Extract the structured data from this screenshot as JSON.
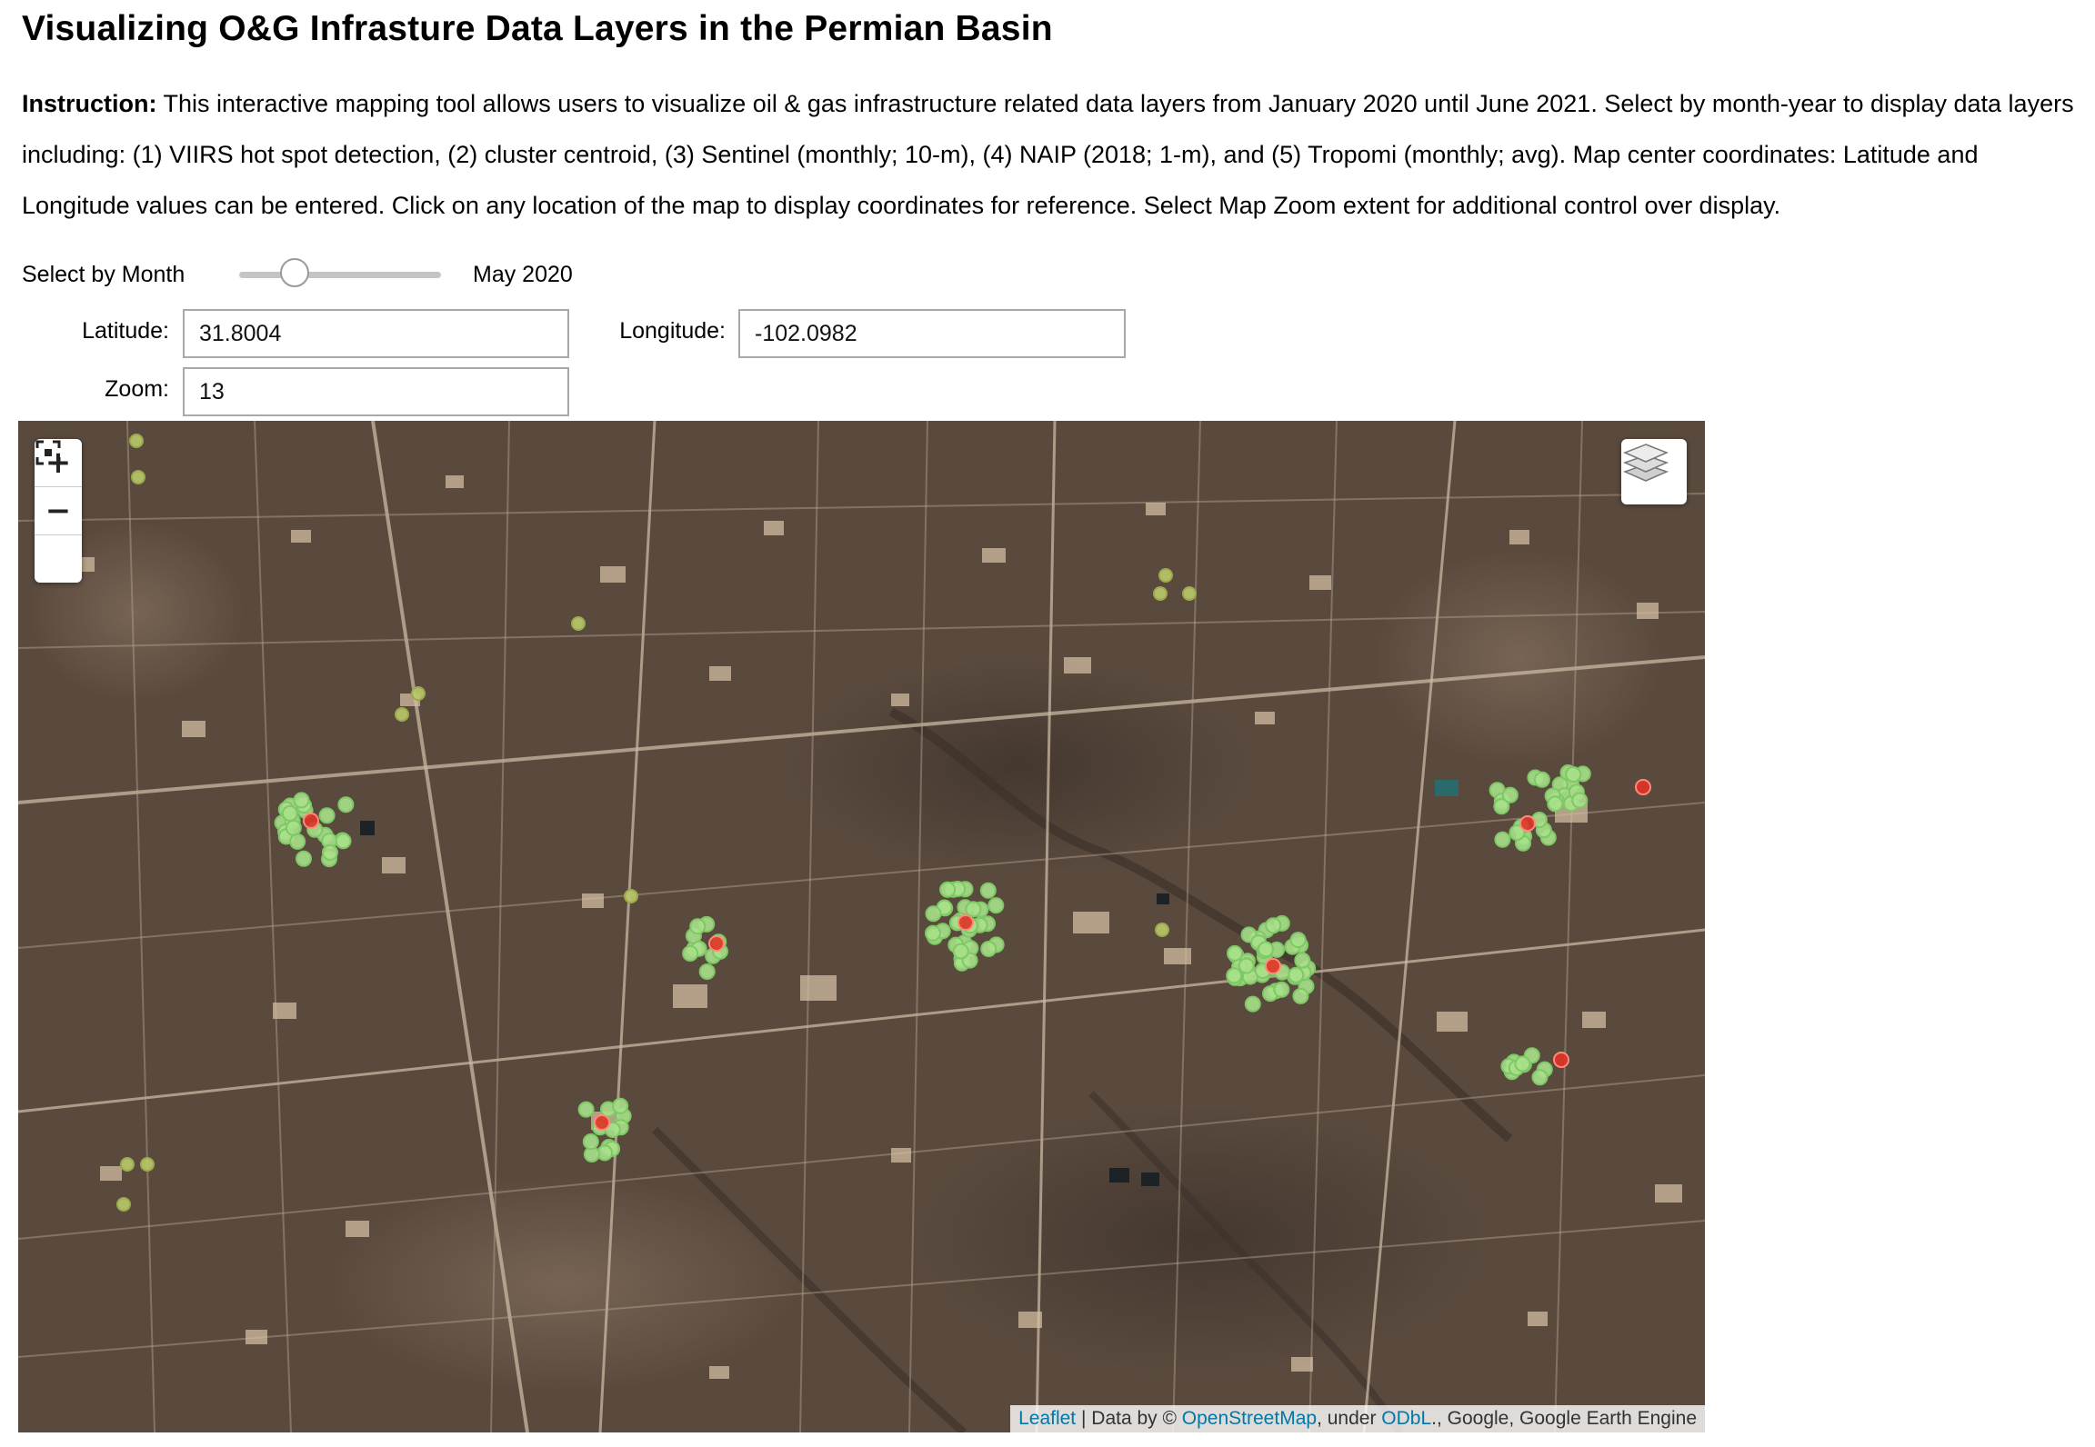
{
  "page": {
    "title": "Visualizing O&G Infrasture Data Layers in the Permian Basin",
    "instruction_lead": "Instruction:",
    "instruction_text": " This interactive mapping tool allows users to visualize oil & gas infrastructure related data layers from January 2020 until June 2021. Select by month-year to display data layers including: (1) VIIRS hot spot detection, (2) cluster centroid, (3) Sentinel (monthly; 10-m), (4) NAIP (2018; 1-m), and (5) Tropomi (monthly; avg). Map center coordinates: Latitude and Longitude values can be entered. Click on any location of the map to display coordinates for reference. Select Map Zoom extent for additional control over display."
  },
  "controls": {
    "month_label": "Select by Month",
    "month_value": "May 2020",
    "month_slider_fraction": 0.2353,
    "latitude_label": "Latitude:",
    "latitude_value": "31.8004",
    "longitude_label": "Longitude:",
    "longitude_value": "-102.0982",
    "zoom_label": "Zoom:",
    "zoom_value": "13"
  },
  "map": {
    "zoom_in": "+",
    "zoom_out": "−",
    "fullscreen_icon": "fullscreen-icon",
    "layers_icon": "layers-icon",
    "attribution": {
      "leaflet": "Leaflet",
      "sep": " | Data by © ",
      "osm": "OpenStreetMap",
      "under": ", under ",
      "odbl": "ODbL",
      "rest": "., Google, Google Earth Engine"
    },
    "colors": {
      "hotspot": "#a8e08a",
      "hotspot_dim": "#b9c96a",
      "centroid": "#e03326"
    }
  }
}
